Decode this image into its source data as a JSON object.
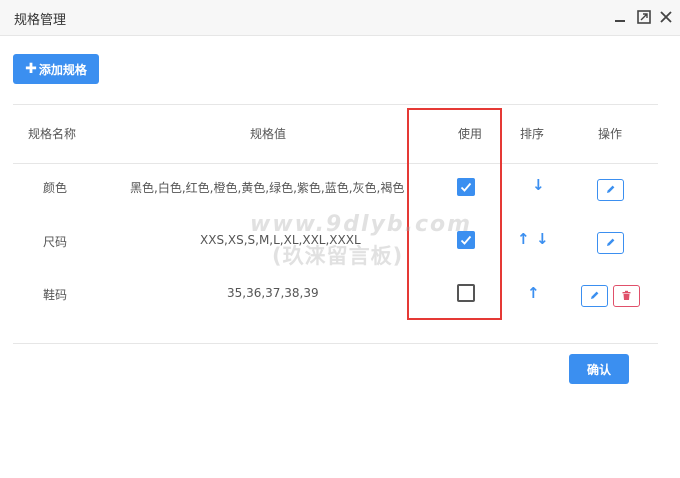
{
  "window": {
    "title": "规格管理",
    "minimize_icon": "minimize-icon",
    "maximize_icon": "maximize-icon",
    "close_icon": "close-icon"
  },
  "toolbar": {
    "add_label": "添加规格"
  },
  "table": {
    "headers": {
      "name": "规格名称",
      "values": "规格值",
      "use": "使用",
      "sort": "排序",
      "action": "操作"
    },
    "rows": [
      {
        "name": "颜色",
        "values": "黑色,白色,红色,橙色,黄色,绿色,紫色,蓝色,灰色,褐色",
        "used": true,
        "sort": [
          "down"
        ],
        "actions": [
          "edit"
        ]
      },
      {
        "name": "尺码",
        "values": "XXS,XS,S,M,L,XL,XXL,XXXL",
        "used": true,
        "sort": [
          "up",
          "down"
        ],
        "actions": [
          "edit"
        ]
      },
      {
        "name": "鞋码",
        "values": "35,36,37,38,39",
        "used": false,
        "sort": [
          "up"
        ],
        "actions": [
          "edit",
          "delete"
        ]
      }
    ]
  },
  "footer": {
    "confirm_label": "确认"
  },
  "watermark": {
    "line1": "www.9dlyb.com",
    "line2": "(玖涞留言板)"
  },
  "colors": {
    "accent": "#3b8ff0",
    "danger": "#e0506a",
    "highlight": "#e53935"
  }
}
